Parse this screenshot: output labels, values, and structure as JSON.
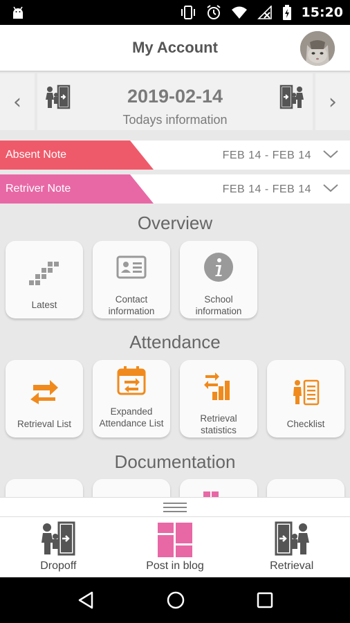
{
  "status_bar": {
    "time": "15:20"
  },
  "header": {
    "title": "My Account"
  },
  "date_bar": {
    "date": "2019-02-14",
    "subtitle": "Todays information",
    "prev": "‹",
    "next": "›"
  },
  "notes": [
    {
      "label": "Absent Note",
      "range": "FEB 14 - FEB 14",
      "color": "#ef5a6a"
    },
    {
      "label": "Retriver Note",
      "range": "FEB 14 - FEB 14",
      "color": "#e868a6"
    }
  ],
  "sections": {
    "overview": {
      "title": "Overview",
      "tiles": [
        {
          "label": "Latest",
          "icon": "stairs-icon"
        },
        {
          "label": "Contact information",
          "icon": "contact-card-icon"
        },
        {
          "label": "School information",
          "icon": "info-icon"
        }
      ]
    },
    "attendance": {
      "title": "Attendance",
      "tiles": [
        {
          "label": "Retrieval List",
          "icon": "swap-arrows-icon"
        },
        {
          "label": "Expanded Attendance List",
          "icon": "calendar-swap-icon"
        },
        {
          "label": "Retrieval statistics",
          "icon": "bar-chart-icon"
        },
        {
          "label": "Checklist",
          "icon": "checklist-icon"
        }
      ]
    },
    "documentation": {
      "title": "Documentation"
    }
  },
  "bottom_nav": [
    {
      "label": "Dropoff",
      "icon": "dropoff-door-icon"
    },
    {
      "label": "Post in blog",
      "icon": "blog-grid-icon"
    },
    {
      "label": "Retrieval",
      "icon": "retrieval-door-icon"
    }
  ],
  "colors": {
    "accent_orange": "#f08a1c",
    "accent_pink": "#e868a6",
    "accent_red": "#ef5a6a"
  }
}
